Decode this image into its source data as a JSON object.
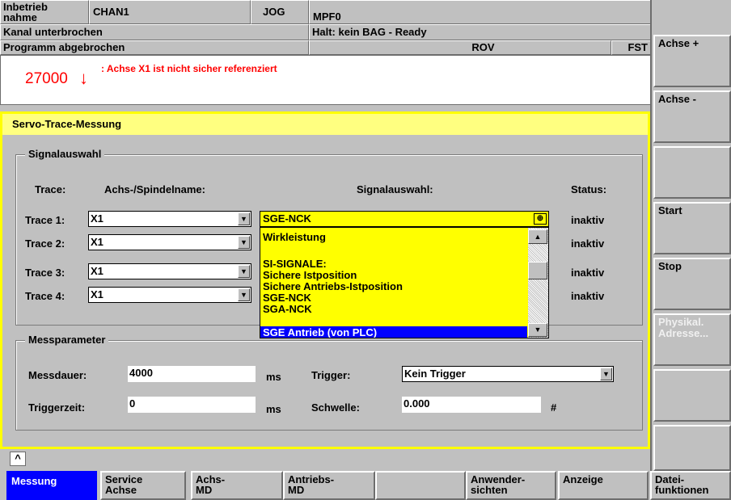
{
  "header": {
    "mode_label": "Inbetrieb\nnahme",
    "channel": "CHAN1",
    "op_mode": "JOG",
    "program": "MPF0",
    "channel_state": "Kanal unterbrochen",
    "halt_text": "Halt: kein BAG - Ready",
    "program_state": "Programm abgebrochen",
    "rov": "ROV",
    "fst": "FST"
  },
  "alarm": {
    "number": "27000",
    "arrow": "↓",
    "text": ": Achse X1 ist nicht sicher referenziert"
  },
  "panel": {
    "title": "Servo-Trace-Messung"
  },
  "signal": {
    "group_label": "Signalauswahl",
    "col_trace": "Trace:",
    "col_axis": "Achs-/Spindelname:",
    "col_signal": "Signalauswahl:",
    "col_status": "Status:",
    "rows": [
      {
        "label": "Trace 1:",
        "axis": "X1",
        "status": "inaktiv"
      },
      {
        "label": "Trace 2:",
        "axis": "X1",
        "status": "inaktiv"
      },
      {
        "label": "Trace 3:",
        "axis": "X1",
        "status": "inaktiv"
      },
      {
        "label": "Trace 4:",
        "axis": "X1",
        "status": "inaktiv"
      }
    ],
    "selected": "SGE-NCK",
    "options": [
      "Wirkleistung",
      "",
      "SI-SIGNALE:",
      "Sichere Istposition",
      "Sichere Antriebs-Istposition",
      "SGE-NCK",
      "SGA-NCK",
      "SGE Antrieb (von PLC)"
    ]
  },
  "params": {
    "group_label": "Messparameter",
    "duration_label": "Messdauer:",
    "duration_value": "4000",
    "duration_unit": "ms",
    "trigger_label": "Trigger:",
    "trigger_value": "Kein Trigger",
    "triggertime_label": "Triggerzeit:",
    "triggertime_value": "0",
    "triggertime_unit": "ms",
    "threshold_label": "Schwelle:",
    "threshold_value": "0.000",
    "threshold_unit": "#"
  },
  "status_bar": {
    "caret": "^"
  },
  "softkeys_right": [
    "Achse +",
    "Achse -",
    "",
    "Start",
    "Stop",
    "Physikal.\nAdresse...",
    "",
    ""
  ],
  "softkeys_bottom": [
    "Messung",
    "Service\nAchse",
    "Achs-\nMD",
    "Antriebs-\nMD",
    "",
    "Anwender-\nsichten",
    "Anzeige",
    "Datei-\nfunktionen"
  ],
  "colors": {
    "accent_yellow": "#ffff00",
    "panel_yellow": "#ffff80",
    "selection_blue": "#0000ff",
    "alarm_red": "#ff0000"
  }
}
